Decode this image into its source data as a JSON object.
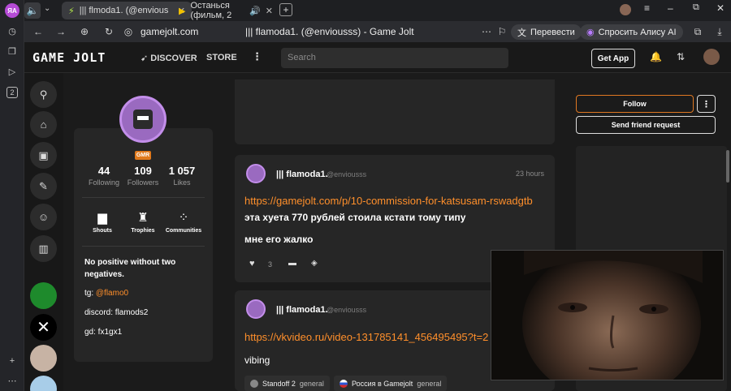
{
  "browser": {
    "tabs": [
      {
        "title": "||| flmoda1. (@envious"
      },
      {
        "title": "Останься (фильм, 2"
      }
    ],
    "url": "gamejolt.com",
    "page_title": "||| flamoda1. (@enviousss) - Game Jolt",
    "translate_label": "Перевести",
    "alice_label": "Спросить Алису AI",
    "sidebar_badge": "2"
  },
  "nav": {
    "logo": "GAME JOLT",
    "discover": "DISCOVER",
    "store": "STORE",
    "search_placeholder": "Search",
    "get_app": "Get App"
  },
  "profile": {
    "badge": "GMR",
    "stats": [
      {
        "num": "44",
        "label": "Following"
      },
      {
        "num": "109",
        "label": "Followers"
      },
      {
        "num": "1 057",
        "label": "Likes"
      }
    ],
    "shortcuts": [
      {
        "label": "Shouts"
      },
      {
        "label": "Trophies"
      },
      {
        "label": "Communities"
      }
    ],
    "bio_line1": "No positive without two",
    "bio_line2": "negatives.",
    "tg_prefix": "tg: ",
    "tg_handle": "@flamo0",
    "discord": "discord: flamods2",
    "gd": "gd: fx1gx1"
  },
  "posts": [
    {
      "name": "||| flamoda1.",
      "handle": "@enviousss",
      "time": "23 hours",
      "link": "https://gamejolt.com/p/10-commission-for-katsusam-rswadgtb",
      "line1": "эта хуета 770 рублей стоила кстати тому типу",
      "line2": "мне его жалко",
      "likes": "3"
    },
    {
      "name": "||| flamoda1.",
      "handle": "@enviousss",
      "link": "https://vkvideo.ru/video-131785141_456495495?t=2",
      "line1": "vibing",
      "tags": [
        {
          "name": "Standoff 2",
          "channel": "general"
        },
        {
          "name": "Россия в Gamejolt",
          "channel": "general"
        }
      ]
    }
  ],
  "actions": {
    "follow": "Follow",
    "more": "⋮",
    "friend_request": "Send friend request"
  }
}
